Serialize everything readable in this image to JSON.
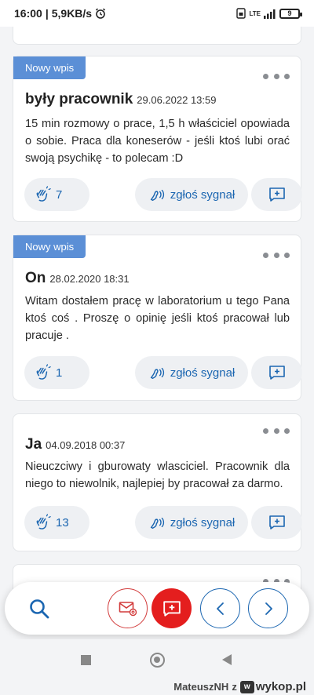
{
  "status_bar": {
    "time": "16:00",
    "speed": "5,9KB/s",
    "network": "LTE",
    "battery": "9"
  },
  "posts": [
    {
      "badge": "Nowy wpis",
      "author": "były pracownik",
      "date": "29.06.2022 13:59",
      "body": "15 min rozmowy o prace, 1,5 h właściciel opowiada o sobie. Praca dla koneserów - jeśli ktoś lubi orać swoją psychikę - to polecam :D",
      "likes": "7",
      "signal_label": "zgłoś sygnał"
    },
    {
      "badge": "Nowy wpis",
      "author": "On",
      "date": "28.02.2020 18:31",
      "body": "Witam dostałem pracę w laboratorium u tego Pana ktoś coś . Proszę o opinię jeśli ktoś pracował lub pracuje .",
      "likes": "1",
      "signal_label": "zgłoś sygnał"
    },
    {
      "author": "Ja",
      "date": "04.09.2018 00:37",
      "body": "Nieuczciwy i gburowaty wlasciciel. Pracownik dla niego to niewolnik, najlepiej by pracował za darmo.",
      "likes": "13",
      "signal_label": "zgłoś sygnał"
    }
  ],
  "watermark": {
    "user": "MateuszNH",
    "connector": "z",
    "site": "wykop.pl"
  },
  "colors": {
    "accent_blue": "#1b66b1",
    "badge_blue": "#5b8fd6",
    "red": "#e41e1e"
  }
}
